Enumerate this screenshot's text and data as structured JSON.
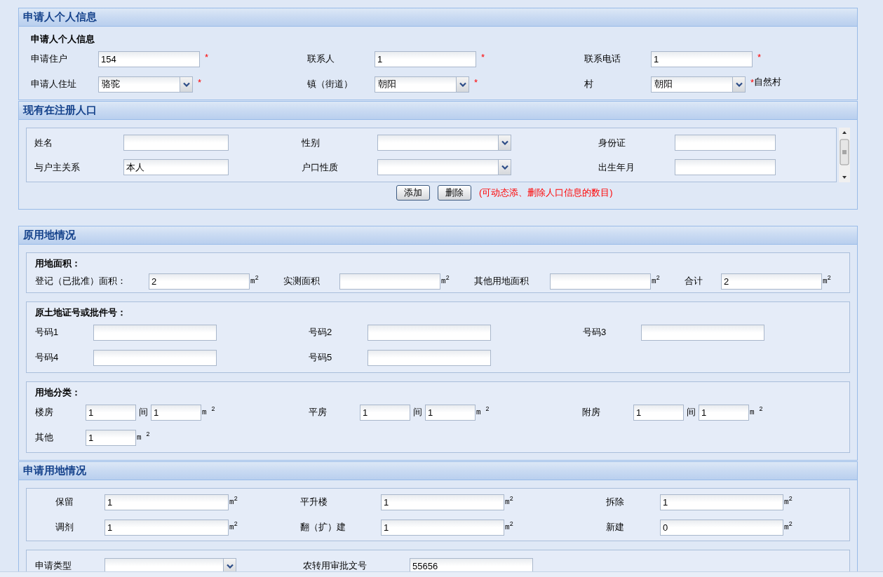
{
  "sections": [
    {
      "title": "申请人个人信息",
      "groups": [
        {
          "kind": "plain",
          "title": "申请人个人信息",
          "rows": [
            [
              {
                "label": "申请住户",
                "kind": "input",
                "value": "154",
                "mark": "*"
              },
              {
                "label": "联系人",
                "kind": "input",
                "value": "1",
                "mark": "*"
              },
              {
                "label": "联系电话",
                "kind": "input",
                "value": "1",
                "mark": "*"
              }
            ],
            [
              {
                "label": "申请人住址",
                "kind": "select",
                "value": "骆驼",
                "mark": "*"
              },
              {
                "label": "镇（街道）",
                "kind": "select",
                "value": "朝阳",
                "mark": "*"
              },
              {
                "label": "村",
                "kind": "select",
                "value": "朝阳",
                "mark": "*",
                "note": "自然村"
              }
            ]
          ]
        }
      ]
    },
    {
      "title": "现有在注册人口",
      "groups": [
        {
          "kind": "list",
          "rows": [
            [
              {
                "label": "姓名",
                "kind": "input"
              },
              {
                "label": "性别",
                "kind": "select"
              },
              {
                "label": "身份证",
                "kind": "input"
              }
            ],
            [
              {
                "label": "与户主关系",
                "kind": "input",
                "value": "本人"
              },
              {
                "label": "户口性质",
                "kind": "select"
              },
              {
                "label": "出生年月",
                "kind": "input"
              }
            ]
          ]
        }
      ],
      "buttons": [
        {
          "label": "添加"
        },
        {
          "label": "删除"
        }
      ],
      "hint": "(可动态添、删除人口信息的数目)"
    },
    {
      "title": "原用地情况",
      "groups": [
        {
          "kind": "area",
          "title": "用地面积：",
          "rows": [
            [
              {
                "label": "登记（已批准）面积：",
                "kind": "input",
                "value": "2",
                "unit": "m$^{2}$"
              },
              {
                "label": "实测面积",
                "kind": "input",
                "unit": "m$^{2}$"
              },
              {
                "label": "其他用地面积",
                "kind": "input",
                "unit": "m$^{2}$"
              },
              {
                "label": "合计",
                "kind": "input",
                "value": "2",
                "unit": "m$^{2}$"
              }
            ]
          ]
        },
        {
          "kind": "numbers",
          "title": "原土地证号或批件号：",
          "rows": [
            [
              {
                "label": "号码1",
                "kind": "input"
              },
              {
                "label": "号码2",
                "kind": "input"
              },
              {
                "label": "号码3",
                "kind": "input"
              }
            ],
            [
              {
                "label": "号码4",
                "kind": "input"
              },
              {
                "label": "号码5",
                "kind": "input"
              }
            ]
          ]
        },
        {
          "kind": "classes",
          "title": "用地分类：",
          "rows": [
            [
              {
                "label": "楼房",
                "kind": "pair",
                "value": "1",
                "between": "间",
                "value2": "1",
                "unit": "m $^{2}$"
              },
              {
                "label": "平房",
                "kind": "pair",
                "value": "1",
                "between": "间",
                "value2": "1",
                "unit": "m $^{2}$"
              },
              {
                "label": "附房",
                "kind": "pair",
                "value": "1",
                "between": "间",
                "value2": "1",
                "unit": "m $^{2}$"
              }
            ],
            [
              {
                "label": "其他",
                "kind": "input",
                "value": "1",
                "unit": "m $^{2}$"
              }
            ]
          ]
        }
      ]
    },
    {
      "title": "申请用地情况",
      "groups": [
        {
          "kind": "apply",
          "rows": [
            [
              {
                "label": "保留",
                "kind": "input",
                "value": "1",
                "unit": "m$^{2}$"
              },
              {
                "label": "平升楼",
                "kind": "input",
                "value": "1",
                "unit": "m$^{2}$"
              },
              {
                "label": "拆除",
                "kind": "input",
                "value": "1",
                "unit": "m$^{2}$"
              }
            ],
            [
              {
                "label": "调剂",
                "kind": "input",
                "value": "1",
                "unit": "m$^{2}$"
              },
              {
                "label": "翻（扩）建",
                "kind": "input",
                "value": "1",
                "unit": "m$^{2}$"
              },
              {
                "label": "新建",
                "kind": "input",
                "value": "0",
                "unit": "m$^{2}$"
              }
            ]
          ]
        },
        {
          "kind": "type",
          "rows": [
            [
              {
                "label": "申请类型",
                "kind": "select"
              },
              {
                "label": "农转用审批文号",
                "kind": "input",
                "value": "55656"
              }
            ]
          ]
        }
      ]
    }
  ]
}
